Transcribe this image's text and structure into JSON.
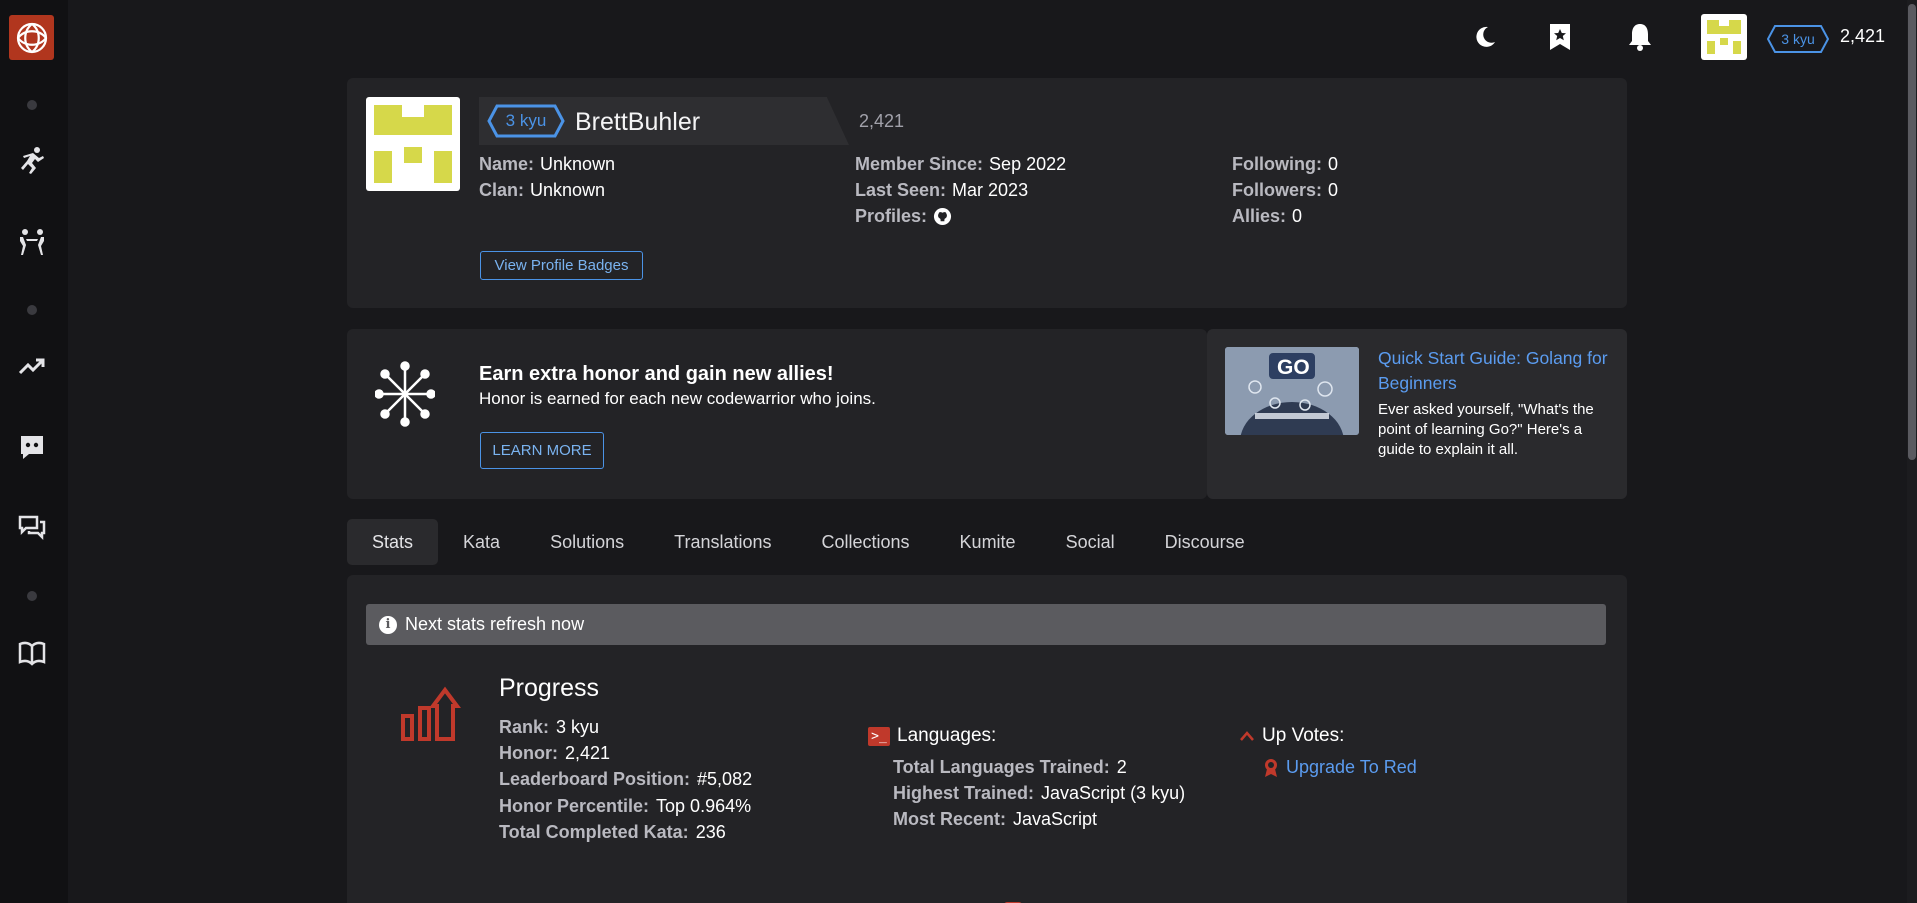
{
  "topbar": {
    "rank": "3 kyu",
    "honor": "2,421"
  },
  "profile": {
    "rank": "3 kyu",
    "username": "BrettBuhler",
    "honor": "2,421",
    "name_label": "Name:",
    "name_value": "Unknown",
    "clan_label": "Clan:",
    "clan_value": "Unknown",
    "member_since_label": "Member Since:",
    "member_since_value": "Sep 2022",
    "last_seen_label": "Last Seen:",
    "last_seen_value": "Mar 2023",
    "profiles_label": "Profiles:",
    "following_label": "Following:",
    "following_value": "0",
    "followers_label": "Followers:",
    "followers_value": "0",
    "allies_label": "Allies:",
    "allies_value": "0",
    "badges_button": "View Profile Badges"
  },
  "promo": {
    "title": "Earn extra honor and gain new allies!",
    "text": "Honor is earned for each new codewarrior who joins.",
    "button": "LEARN MORE"
  },
  "guide": {
    "image_text": "GO",
    "title": "Quick Start Guide: Golang for Beginners",
    "text": "Ever asked yourself, \"What's the point of learning Go?\" Here's a guide to explain it all."
  },
  "tabs": [
    "Stats",
    "Kata",
    "Solutions",
    "Translations",
    "Collections",
    "Kumite",
    "Social",
    "Discourse"
  ],
  "stats": {
    "refresh_text": "Next stats refresh now",
    "progress_title": "Progress",
    "progress": [
      {
        "k": "Rank:",
        "v": "3 kyu"
      },
      {
        "k": "Honor:",
        "v": "2,421"
      },
      {
        "k": "Leaderboard Position:",
        "v": "#5,082"
      },
      {
        "k": "Honor Percentile:",
        "v": "Top 0.964%"
      },
      {
        "k": "Total Completed Kata:",
        "v": "236"
      }
    ],
    "languages_title": "Languages:",
    "languages": [
      {
        "k": "Total Languages Trained:",
        "v": "2"
      },
      {
        "k": "Highest Trained:",
        "v": "JavaScript (3 kyu)"
      },
      {
        "k": "Most Recent:",
        "v": "JavaScript"
      }
    ],
    "upvotes_title": "Up Votes:",
    "upvotes_link": "Upgrade To Red"
  },
  "colors": {
    "accent_red": "#b1361e",
    "rank_blue": "#4b93e6",
    "avatar_yellow": "#d6d84a"
  }
}
